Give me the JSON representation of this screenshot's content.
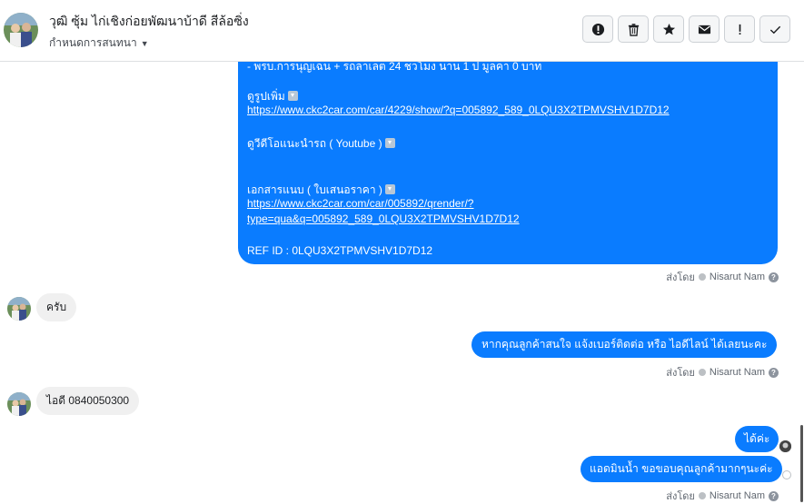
{
  "header": {
    "contact_name": "วุฒิ ซุ้ม ไก่เชิงก่อยพัฒนาบ้าดี สีล้อซิ่ง",
    "assign_label": "กำหนดการสนทนา",
    "actions": [
      {
        "icon": "alert-circle-icon",
        "label": "Mark as spam"
      },
      {
        "icon": "trash-icon",
        "label": "Delete"
      },
      {
        "icon": "star-icon",
        "label": "Star"
      },
      {
        "icon": "envelope-icon",
        "label": "Mark as unread"
      },
      {
        "icon": "exclamation-icon",
        "label": "Follow up"
      },
      {
        "icon": "check-icon",
        "label": "Mark as done"
      }
    ]
  },
  "messages": {
    "big_block": {
      "line_top": "- พรบ.การนุญเฉน + รถลาเลต 24 ชวโมง นาน 1 ป    มูลคา 0 บาท",
      "photos_label": "ดูรูปเพิ่ม",
      "photos_link": "https://www.ckc2car.com/car/4229/show/?q=005892_589_0LQU3X2TPMVSHV1D7D12",
      "video_label": "ดูวีดีโอแนะนำรถ ( Youtube )",
      "doc_label": "เอกสารแนบ ( ใบเสนอราคา )",
      "doc_link_1": "https://www.ckc2car.com/car/005892/qrender/?",
      "doc_link_2": "type=qua&q=005892_589_0LQU3X2TPMVSHV1D7D12",
      "ref_id": "REF ID : 0LQU3X2TPMVSHV1D7D12"
    },
    "sent_by_prefix": "ส่งโดย",
    "sent_by_name": "Nisarut Nam",
    "help_glyph": "?",
    "reply_1": "ครับ",
    "agent_1": "หากคุณลูกค้าสนใจ แจ้งเบอร์ติดต่อ หรือ ไอดีไลน์ ได้เลยนะคะ",
    "reply_2": "ไอดี 0840050300",
    "agent_2": "ได้ค่ะ",
    "agent_3": "แอดมินน้ำ ขอขอบคุณลูกค้ามากๆนะค่ะ"
  }
}
